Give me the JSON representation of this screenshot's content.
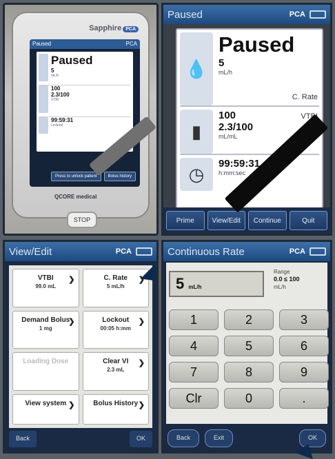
{
  "device": {
    "brand": "Sapphire",
    "brand_tag": "PCA",
    "screen_title": "Paused",
    "screen_mode": "PCA",
    "mini_status": "Paused",
    "mini_rate": "5",
    "mini_rate_unit": "mL/h",
    "mini_vtbi": "100",
    "mini_vtbi2": "2.3/100",
    "mini_vtbi_label": "VTBI",
    "mini_timer": "99:59:31",
    "mini_timer_sub": "Lockout",
    "btn_press": "Press to unlock patient",
    "btn_bolus": "Bolus history",
    "logo": "QCORE medical",
    "stop": "STOP"
  },
  "paused": {
    "title": "Paused",
    "mode": "PCA",
    "status": "Paused",
    "rate_value": "5",
    "rate_unit": "mL/h",
    "rate_label": "C. Rate",
    "vtbi_value": "100",
    "vtbi_progress": "2.3/100",
    "vtbi_unit": "mL/mL",
    "vtbi_label": "VTBI",
    "timer": "99:59:31",
    "timer_sub": "h:mm:sec",
    "bottom": [
      "Prime",
      "View/Edit",
      "Continue",
      "Quit"
    ]
  },
  "view_edit": {
    "title": "View/Edit",
    "mode": "PCA",
    "cells": [
      {
        "label": "VTBI",
        "sub": "99.0 mL",
        "dim": false
      },
      {
        "label": "C. Rate",
        "sub": "5 mL/h",
        "dim": false
      },
      {
        "label": "Demand Bolus",
        "sub": "1 mg",
        "dim": false
      },
      {
        "label": "Lockout",
        "sub": "00:05 h:mm",
        "dim": false
      },
      {
        "label": "Loading Dose",
        "sub": "",
        "dim": true
      },
      {
        "label": "Clear VI",
        "sub": "2.3 mL",
        "dim": false
      },
      {
        "label": "View system",
        "sub": "",
        "dim": false
      },
      {
        "label": "Bolus History",
        "sub": "",
        "dim": false
      }
    ],
    "back": "Back",
    "ok": "OK"
  },
  "keypad": {
    "title": "Continuous Rate",
    "mode": "PCA",
    "value": "5",
    "value_unit": "mL/h",
    "range_label": "Range",
    "range_value": "0.0 ≤ 100",
    "range_unit": "mL/h",
    "keys": [
      "1",
      "2",
      "3",
      "4",
      "5",
      "6",
      "7",
      "8",
      "9",
      "Clr",
      "0",
      "."
    ],
    "back": "Back",
    "exit": "Exit",
    "ok": "OK"
  }
}
